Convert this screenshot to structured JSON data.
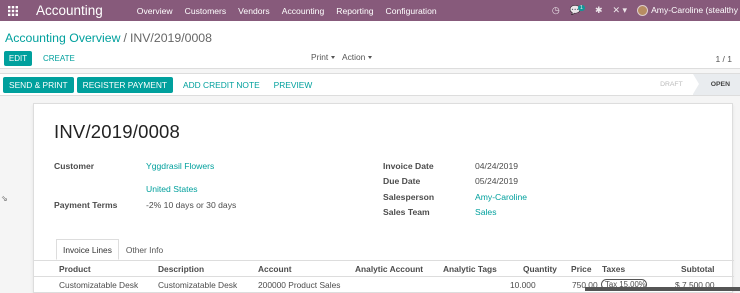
{
  "navbar": {
    "brand": "Accounting",
    "menu": [
      "Overview",
      "Customers",
      "Vendors",
      "Accounting",
      "Reporting",
      "Configuration"
    ],
    "messages_count": "1",
    "user": "Amy-Caroline (stealthy"
  },
  "control": {
    "breadcrumb_parent": "Accounting Overview",
    "breadcrumb_sep": "/",
    "breadcrumb_current": "INV/2019/0008",
    "edit_label": "EDIT",
    "create_label": "CREATE",
    "print_label": "Print",
    "action_label": "Action",
    "pager": "1 / 1"
  },
  "statusbar": {
    "send_print": "SEND & PRINT",
    "register_payment": "REGISTER PAYMENT",
    "add_credit_note": "ADD CREDIT NOTE",
    "preview": "PREVIEW",
    "stages": [
      "DRAFT",
      "OPEN"
    ],
    "active_stage": "OPEN"
  },
  "invoice": {
    "number": "INV/2019/0008",
    "customer_label": "Customer",
    "customer": "Yggdrasil Flowers",
    "customer_country": "United States",
    "payment_terms_label": "Payment Terms",
    "payment_terms": "-2% 10 days or 30 days",
    "invoice_date_label": "Invoice Date",
    "invoice_date": "04/24/2019",
    "due_date_label": "Due Date",
    "due_date": "05/24/2019",
    "salesperson_label": "Salesperson",
    "salesperson": "Amy-Caroline",
    "sales_team_label": "Sales Team",
    "sales_team": "Sales"
  },
  "tabs": [
    "Invoice Lines",
    "Other Info"
  ],
  "lines": {
    "headers": [
      "Product",
      "Description",
      "Account",
      "Analytic Account",
      "Analytic Tags",
      "Quantity",
      "Price",
      "Taxes",
      "Subtotal"
    ],
    "rows": [
      {
        "product": "Customizatable Desk",
        "description": "Customizatable Desk",
        "account": "200000 Product Sales",
        "analytic_account": "",
        "analytic_tags": "",
        "quantity": "10.000",
        "price": "750.00",
        "taxes": "Tax 15.00%",
        "subtotal": "$ 7,500.00"
      }
    ]
  },
  "colors": {
    "brand": "#875a7b",
    "accent": "#00a09d"
  }
}
